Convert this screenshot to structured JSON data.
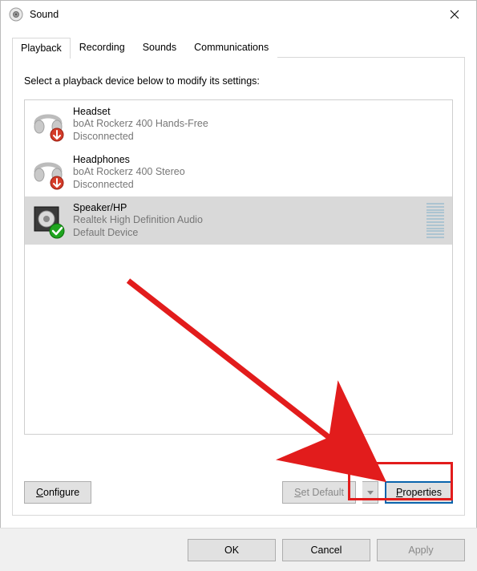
{
  "window": {
    "title": "Sound"
  },
  "tabs": [
    {
      "label": "Playback",
      "active": true
    },
    {
      "label": "Recording",
      "active": false
    },
    {
      "label": "Sounds",
      "active": false
    },
    {
      "label": "Communications",
      "active": false
    }
  ],
  "instruction": "Select a playback device below to modify its settings:",
  "devices": [
    {
      "name": "Headset",
      "detail": "boAt Rockerz 400 Hands-Free",
      "status": "Disconnected",
      "badge": "down",
      "selected": false,
      "icon": "headset"
    },
    {
      "name": "Headphones",
      "detail": "boAt Rockerz 400 Stereo",
      "status": "Disconnected",
      "badge": "down",
      "selected": false,
      "icon": "headset"
    },
    {
      "name": "Speaker/HP",
      "detail": "Realtek High Definition Audio",
      "status": "Default Device",
      "badge": "check",
      "selected": true,
      "icon": "speaker"
    }
  ],
  "buttons": {
    "configure": "Configure",
    "set_default": "Set Default",
    "properties": "Properties",
    "ok": "OK",
    "cancel": "Cancel",
    "apply": "Apply"
  }
}
